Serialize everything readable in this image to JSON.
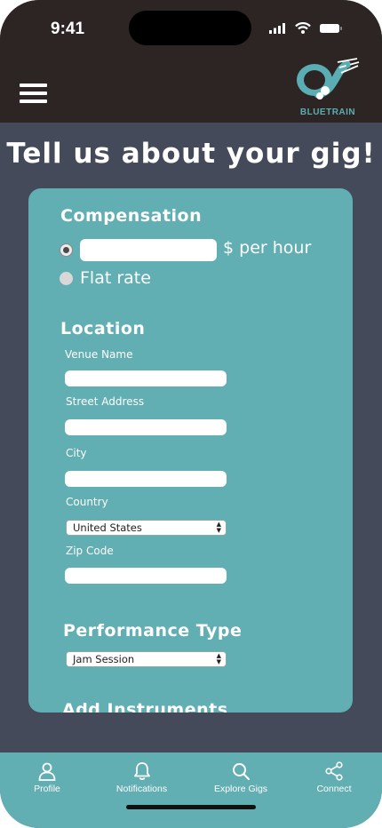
{
  "status_bar": {
    "time": "9:41"
  },
  "header": {
    "logo_text": "BLUETRAIN"
  },
  "page": {
    "title": "Tell us about your gig!"
  },
  "compensation": {
    "title": "Compensation",
    "hourly_suffix": "$ per hour",
    "hourly_value": "",
    "flat_rate_label": "Flat rate",
    "selected": "hourly"
  },
  "location": {
    "title": "Location",
    "venue_label": "Venue Name",
    "venue_value": "",
    "street_label": "Street Address",
    "street_value": "",
    "city_label": "City",
    "city_value": "",
    "country_label": "Country",
    "country_selected": "United States",
    "zip_label": "Zip Code",
    "zip_value": ""
  },
  "performance": {
    "title": "Performance Type",
    "selected": "Jam Session"
  },
  "instruments": {
    "title": "Add Instruments"
  },
  "nav": {
    "profile": "Profile",
    "notifications": "Notifications",
    "explore": "Explore Gigs",
    "connect": "Connect"
  },
  "colors": {
    "background": "#444a59",
    "header": "#2d2523",
    "accent": "#61aeb3"
  }
}
